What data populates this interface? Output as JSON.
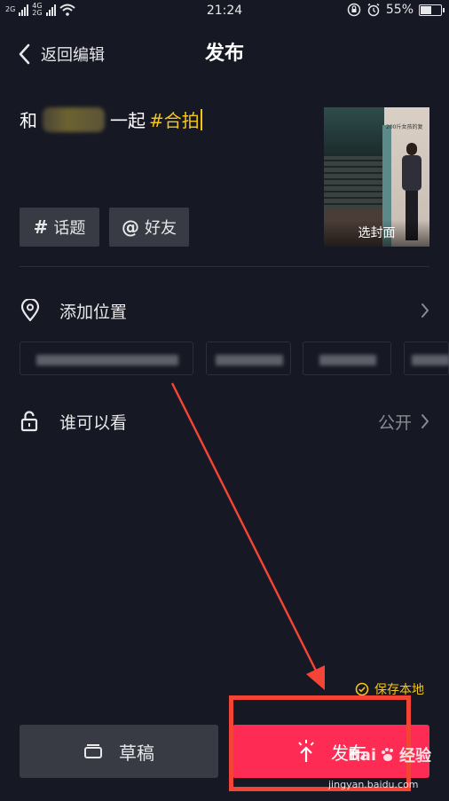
{
  "status_bar": {
    "net1": "2G",
    "net2": "4G",
    "net3": "2G",
    "time": "21:24",
    "battery": "55%",
    "battery_level": 0.55
  },
  "header": {
    "back_label": "返回编辑",
    "title": "发布"
  },
  "caption": {
    "prefix": "和",
    "suffix": "一起",
    "hashtag": "#合拍"
  },
  "cover": {
    "label": "选封面",
    "inner_text": "200斤女孩的复"
  },
  "chips": {
    "topic": {
      "symbol": "#",
      "label": "话题"
    },
    "friend": {
      "symbol": "@",
      "label": "好友"
    }
  },
  "location": {
    "label": "添加位置"
  },
  "visibility": {
    "label": "谁可以看",
    "value": "公开"
  },
  "save_local": {
    "label": "保存本地"
  },
  "footer": {
    "draft_label": "草稿",
    "publish_label": "发布"
  },
  "watermark": {
    "text": "Bai",
    "text2": "经验",
    "url": "jingyan.baidu.com"
  },
  "colors": {
    "background": "#161823",
    "accent": "#fe2c55",
    "hashtag": "#f5c518",
    "annotation": "#f24437"
  }
}
